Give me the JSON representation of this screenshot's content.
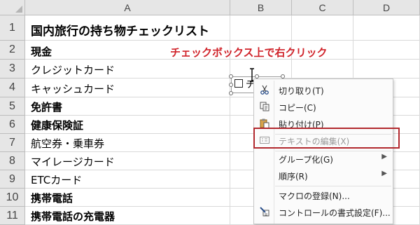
{
  "columns": [
    "A",
    "B",
    "C",
    "D"
  ],
  "rows": [
    "1",
    "2",
    "3",
    "4",
    "5",
    "6",
    "7",
    "8",
    "9",
    "10",
    "11"
  ],
  "cells": {
    "a1": "国内旅行の持ち物チェックリスト",
    "a2": "現金",
    "a3": "クレジットカード",
    "a4": "キャッシュカード",
    "a5": "免許書",
    "a6": "健康保険証",
    "a7": "航空券・乗車券",
    "a8": "マイレージカード",
    "a9": "ETCカード",
    "a10": "携帯電話",
    "a11": "携帯電話の充電器"
  },
  "annotation": "チェックボックス上で右クリック",
  "checkbox": {
    "label": "チェ",
    "checked": false
  },
  "context_menu": {
    "items": [
      {
        "label": "切り取り(T)",
        "icon": "scissors-icon",
        "enabled": true
      },
      {
        "label": "コピー(C)",
        "icon": "copy-icon",
        "enabled": true
      },
      {
        "label": "貼り付け(P)",
        "icon": "paste-icon",
        "enabled": true
      },
      {
        "label": "テキストの編集(X)",
        "icon": "edit-text-icon",
        "enabled": false
      },
      {
        "label": "グループ化(G)",
        "icon": "",
        "enabled": true,
        "submenu": true
      },
      {
        "label": "順序(R)",
        "icon": "",
        "enabled": true,
        "submenu": true
      },
      {
        "label": "マクロの登録(N)...",
        "icon": "",
        "enabled": true
      },
      {
        "label": "コントロールの書式設定(F)...",
        "icon": "format-control-icon",
        "enabled": true
      }
    ]
  },
  "colors": {
    "annotation": "#d0232a",
    "highlight_box": "#b2292e"
  }
}
